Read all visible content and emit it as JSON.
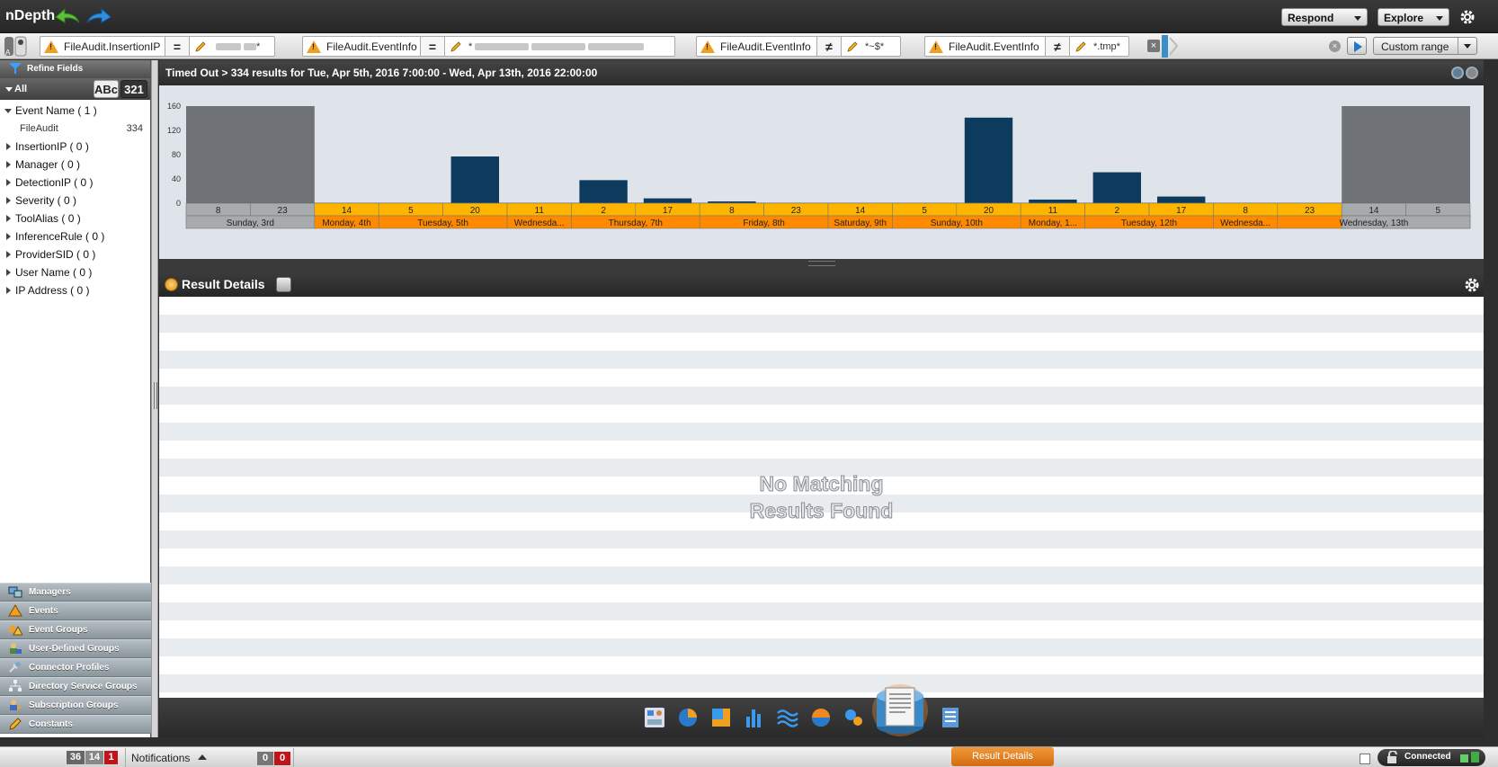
{
  "app": {
    "title": "nDepth",
    "respond_label": "Respond",
    "explore_label": "Explore"
  },
  "filters": [
    {
      "field": "FileAudit.InsertionIP",
      "operator": "=",
      "value": "*",
      "value_redacted": true
    },
    {
      "field": "FileAudit.EventInfo",
      "operator": "=",
      "value": "*",
      "value_redacted": true
    },
    {
      "field": "FileAudit.EventInfo",
      "operator": "≠",
      "value": "*~$*",
      "value_redacted": false
    },
    {
      "field": "FileAudit.EventInfo",
      "operator": "≠",
      "value": "*.tmp*",
      "value_redacted": false
    }
  ],
  "time_range_label": "Custom range",
  "refine": {
    "header": "Refine Fields",
    "all_label": "All",
    "sort_alpha_label": "ABc",
    "sort_num_label": "321",
    "fields": [
      {
        "label": "Event Name ( 1 )",
        "expanded": true,
        "children": [
          {
            "label": "FileAudit",
            "count": "334"
          }
        ]
      },
      {
        "label": "InsertionIP ( 0 )",
        "expanded": false
      },
      {
        "label": "Manager ( 0 )",
        "expanded": false
      },
      {
        "label": "DetectionIP ( 0 )",
        "expanded": false
      },
      {
        "label": "Severity ( 0 )",
        "expanded": false
      },
      {
        "label": "ToolAlias ( 0 )",
        "expanded": false
      },
      {
        "label": "InferenceRule ( 0 )",
        "expanded": false
      },
      {
        "label": "ProviderSID ( 0 )",
        "expanded": false
      },
      {
        "label": "User Name ( 0 )",
        "expanded": false
      },
      {
        "label": "IP Address ( 0 )",
        "expanded": false
      }
    ]
  },
  "nav_items": [
    {
      "label": "Managers",
      "icon": "managers-icon"
    },
    {
      "label": "Events",
      "icon": "warning-icon"
    },
    {
      "label": "Event Groups",
      "icon": "event-groups-icon"
    },
    {
      "label": "User-Defined Groups",
      "icon": "user-groups-icon"
    },
    {
      "label": "Connector Profiles",
      "icon": "connector-icon"
    },
    {
      "label": "Directory Service Groups",
      "icon": "directory-icon"
    },
    {
      "label": "Subscription Groups",
      "icon": "subscription-icon"
    },
    {
      "label": "Constants",
      "icon": "pencil-icon"
    }
  ],
  "chart_header": "Timed Out > 334 results for Tue, Apr 5th, 2016 7:00:00 - Wed, Apr 13th, 2016 22:00:00",
  "chart_data": {
    "type": "bar",
    "ylim": [
      0,
      160
    ],
    "yticks": [
      0,
      40,
      80,
      120,
      160
    ],
    "hour_labels": [
      "8",
      "23",
      "14",
      "5",
      "20",
      "11",
      "2",
      "17",
      "8",
      "23",
      "14",
      "5",
      "20",
      "11",
      "2",
      "17",
      "8",
      "23",
      "14",
      "5"
    ],
    "day_labels": [
      "Sunday, 3rd",
      "Monday, 4th",
      "Tuesday, 5th",
      "Wednesda...",
      "Thursday, 7th",
      "Friday, 8th",
      "Saturday, 9th",
      "Sunday, 10th",
      "Monday, 1...",
      "Tuesday, 12th",
      "Wednesda...",
      "Wednesday, 13th"
    ],
    "day_spans": [
      2,
      1,
      2,
      1,
      2,
      2,
      1,
      2,
      1,
      2,
      1,
      3
    ],
    "selection": {
      "start_hour_index": 2,
      "end_hour_index": 18
    },
    "bars": [
      {
        "hour_index": 4,
        "value": 77
      },
      {
        "hour_index": 6,
        "value": 38
      },
      {
        "hour_index": 7,
        "value": 8
      },
      {
        "hour_index": 8,
        "value": 3
      },
      {
        "hour_index": 12,
        "value": 141
      },
      {
        "hour_index": 13,
        "value": 6
      },
      {
        "hour_index": 14,
        "value": 51
      },
      {
        "hour_index": 15,
        "value": 11
      }
    ],
    "colors": {
      "bar": "#0c3b5e",
      "outside": "#6f7276",
      "selected": "#ffb400",
      "day_row": "#ff8a00",
      "unselected_axis": "#a7abae"
    }
  },
  "details": {
    "title": "Result Details",
    "empty_line1": "No Matching",
    "empty_line2": "Results Found"
  },
  "viz_icons": [
    "dashboard-icon",
    "globe-chart-icon",
    "gradient-icon",
    "bar-chart-icon",
    "wave-icon",
    "sphere-icon",
    "bubble-icon",
    "result-details-icon",
    "export-icon"
  ],
  "status": {
    "count1": "36",
    "count2": "14",
    "count3": "1",
    "notifications_label": "Notifications",
    "notif_count1": "0",
    "notif_count2": "0",
    "result_tab": "Result Details",
    "connection": "Connected"
  }
}
